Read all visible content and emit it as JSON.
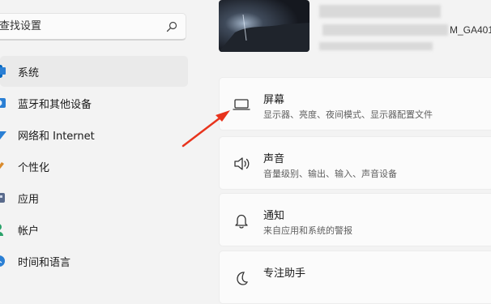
{
  "search": {
    "placeholder": "查找设置"
  },
  "sidebar": {
    "items": [
      {
        "label": "系统",
        "icon": "monitor-icon",
        "active": true
      },
      {
        "label": "蓝牙和其他设备",
        "icon": "bluetooth-icon"
      },
      {
        "label": "网络和 Internet",
        "icon": "wifi-icon"
      },
      {
        "label": "个性化",
        "icon": "brush-icon"
      },
      {
        "label": "应用",
        "icon": "apps-icon"
      },
      {
        "label": "帐户",
        "icon": "person-icon"
      },
      {
        "label": "时间和语言",
        "icon": "globe-clock-icon"
      }
    ]
  },
  "header": {
    "device_name_suffix": "M_GA401"
  },
  "cards": [
    {
      "title": "屏幕",
      "subtitle": "显示器、亮度、夜间模式、显示器配置文件",
      "icon": "display-icon"
    },
    {
      "title": "声音",
      "subtitle": "音量级别、输出、输入、声音设备",
      "icon": "speaker-icon"
    },
    {
      "title": "通知",
      "subtitle": "来自应用和系统的警报",
      "icon": "bell-icon"
    },
    {
      "title": "专注助手",
      "subtitle": "",
      "icon": "moon-icon"
    }
  ],
  "colors": {
    "accent": "#0067c0",
    "annotation": "#e8331c",
    "background": "#f3f3f3"
  }
}
